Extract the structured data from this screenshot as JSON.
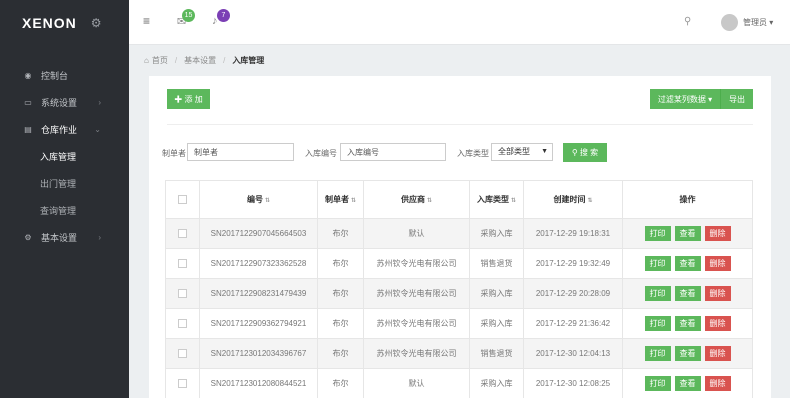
{
  "app": {
    "logo": "XENON"
  },
  "sidebar": {
    "items": [
      {
        "label": "控制台",
        "icon": "palette-icon",
        "expandable": false
      },
      {
        "label": "系统设置",
        "icon": "monitor-icon",
        "expandable": true
      },
      {
        "label": "仓库作业",
        "icon": "book-icon",
        "expandable": true
      }
    ],
    "sub_items": [
      "入库管理",
      "出门管理",
      "查询管理"
    ],
    "bottom_item": {
      "label": "基本设置",
      "icon": "gear-icon",
      "expandable": true
    }
  },
  "header": {
    "mail_badge": "15",
    "bell_badge": "7",
    "user_name": "管理员",
    "colors": {
      "mail_badge": "#5cb85c",
      "bell_badge": "#7b3fb5"
    }
  },
  "breadcrumb": [
    "首页",
    "基本设置",
    "入库管理"
  ],
  "toolbar": {
    "add_label": "添 加",
    "filter_label": "过滤某列数据",
    "export_label": "导出"
  },
  "filters": {
    "maker_label": "制单者",
    "maker_value": "制单者",
    "code_label": "入库编号",
    "code_value": "入库编号",
    "type_label": "入库类型",
    "type_selected": "全部类型",
    "search_label": "搜 索"
  },
  "table": {
    "headers": [
      "编号",
      "制单者",
      "供应商",
      "入库类型",
      "创建时间",
      "操作"
    ],
    "rows": [
      {
        "code": "SN2017122907045664503",
        "maker": "布尔",
        "supplier": "默认",
        "type": "采购入库",
        "time": "2017-12-29 19:18:31"
      },
      {
        "code": "SN2017122907323362528",
        "maker": "布尔",
        "supplier": "苏州钦令光电有限公司",
        "type": "销售退货",
        "time": "2017-12-29 19:32:49"
      },
      {
        "code": "SN2017122908231479439",
        "maker": "布尔",
        "supplier": "苏州钦令光电有限公司",
        "type": "采购入库",
        "time": "2017-12-29 20:28:09"
      },
      {
        "code": "SN2017122909362794921",
        "maker": "布尔",
        "supplier": "苏州钦令光电有限公司",
        "type": "采购入库",
        "time": "2017-12-29 21:36:42"
      },
      {
        "code": "SN2017123012034396767",
        "maker": "布尔",
        "supplier": "苏州钦令光电有限公司",
        "type": "销售退货",
        "time": "2017-12-30 12:04:13"
      },
      {
        "code": "SN2017123012080844521",
        "maker": "布尔",
        "supplier": "默认",
        "type": "采购入库",
        "time": "2017-12-30 12:08:25"
      }
    ],
    "actions": {
      "print": "打印",
      "view": "查看",
      "delete": "删除"
    }
  }
}
